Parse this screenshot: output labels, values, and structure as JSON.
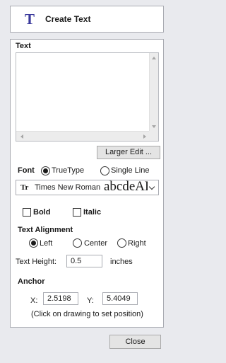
{
  "header": {
    "icon": "T",
    "title": "Create Text"
  },
  "text_section": {
    "label": "Text",
    "value": "",
    "larger_edit_label": "Larger Edit ..."
  },
  "font_section": {
    "label": "Font",
    "options": [
      "TrueType",
      "Single Line"
    ],
    "selected": "TrueType",
    "font_icon": "Tr",
    "font_name": "Times New Roman",
    "preview": "abcdeABC"
  },
  "style": {
    "bold_label": "Bold",
    "italic_label": "Italic",
    "bold": false,
    "italic": false
  },
  "alignment": {
    "label": "Text Alignment",
    "options": [
      "Left",
      "Center",
      "Right"
    ],
    "selected": "Left"
  },
  "height": {
    "label": "Text Height:",
    "value": "0.5",
    "unit": "inches"
  },
  "anchor": {
    "label": "Anchor",
    "x_label": "X:",
    "x_value": "2.5198",
    "y_label": "Y:",
    "y_value": "5.4049",
    "hint": "(Click on drawing to set position)"
  },
  "footer": {
    "close_label": "Close"
  }
}
